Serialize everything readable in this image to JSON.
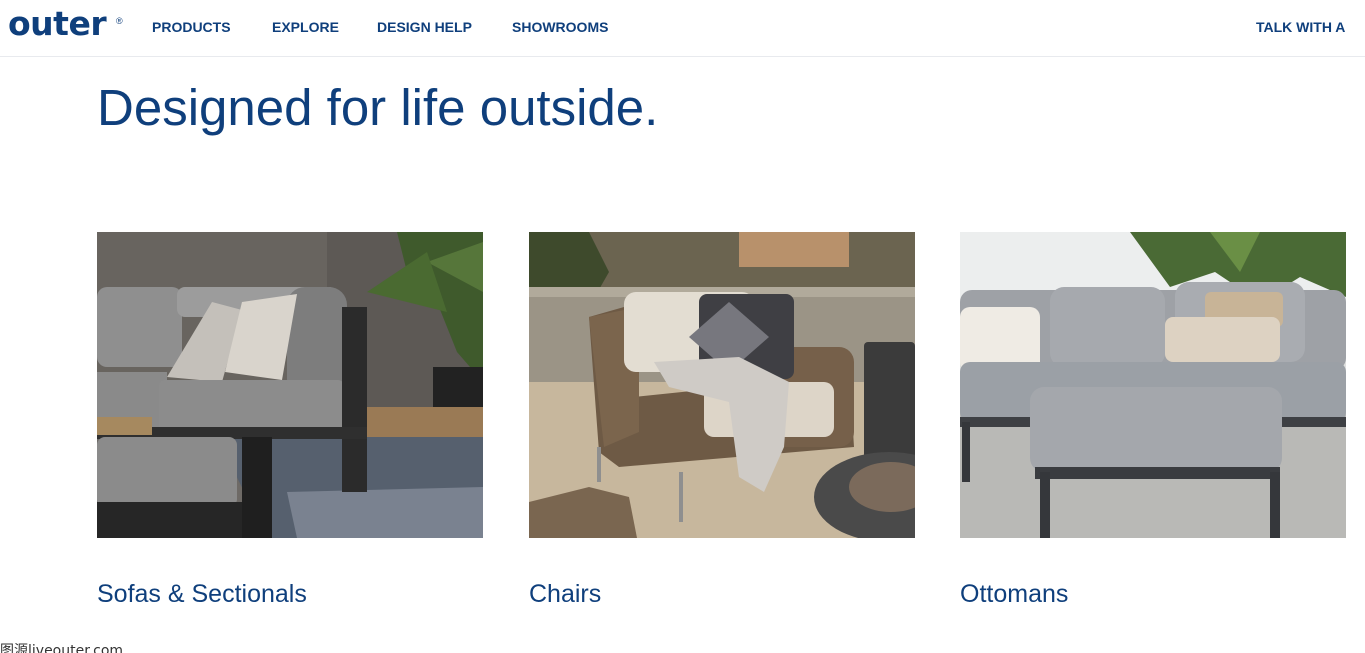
{
  "header": {
    "logo_text": "outer",
    "logo_mark": "®",
    "nav": [
      {
        "label": "PRODUCTS"
      },
      {
        "label": "EXPLORE"
      },
      {
        "label": "DESIGN HELP"
      },
      {
        "label": "SHOWROOMS"
      }
    ],
    "cta_label": "TALK WITH A"
  },
  "hero": {
    "title": "Designed for life outside."
  },
  "categories": [
    {
      "label": "Sofas & Sectionals",
      "image": "sectional-sofa-photo"
    },
    {
      "label": "Chairs",
      "image": "wicker-lounge-chair-photo"
    },
    {
      "label": "Ottomans",
      "image": "ottoman-sectional-photo"
    }
  ],
  "footer": {
    "credit": "图源liveouter.com"
  },
  "colors": {
    "brand_navy": "#0f3f7c",
    "background": "#ffffff",
    "divider": "#e8eaee"
  }
}
